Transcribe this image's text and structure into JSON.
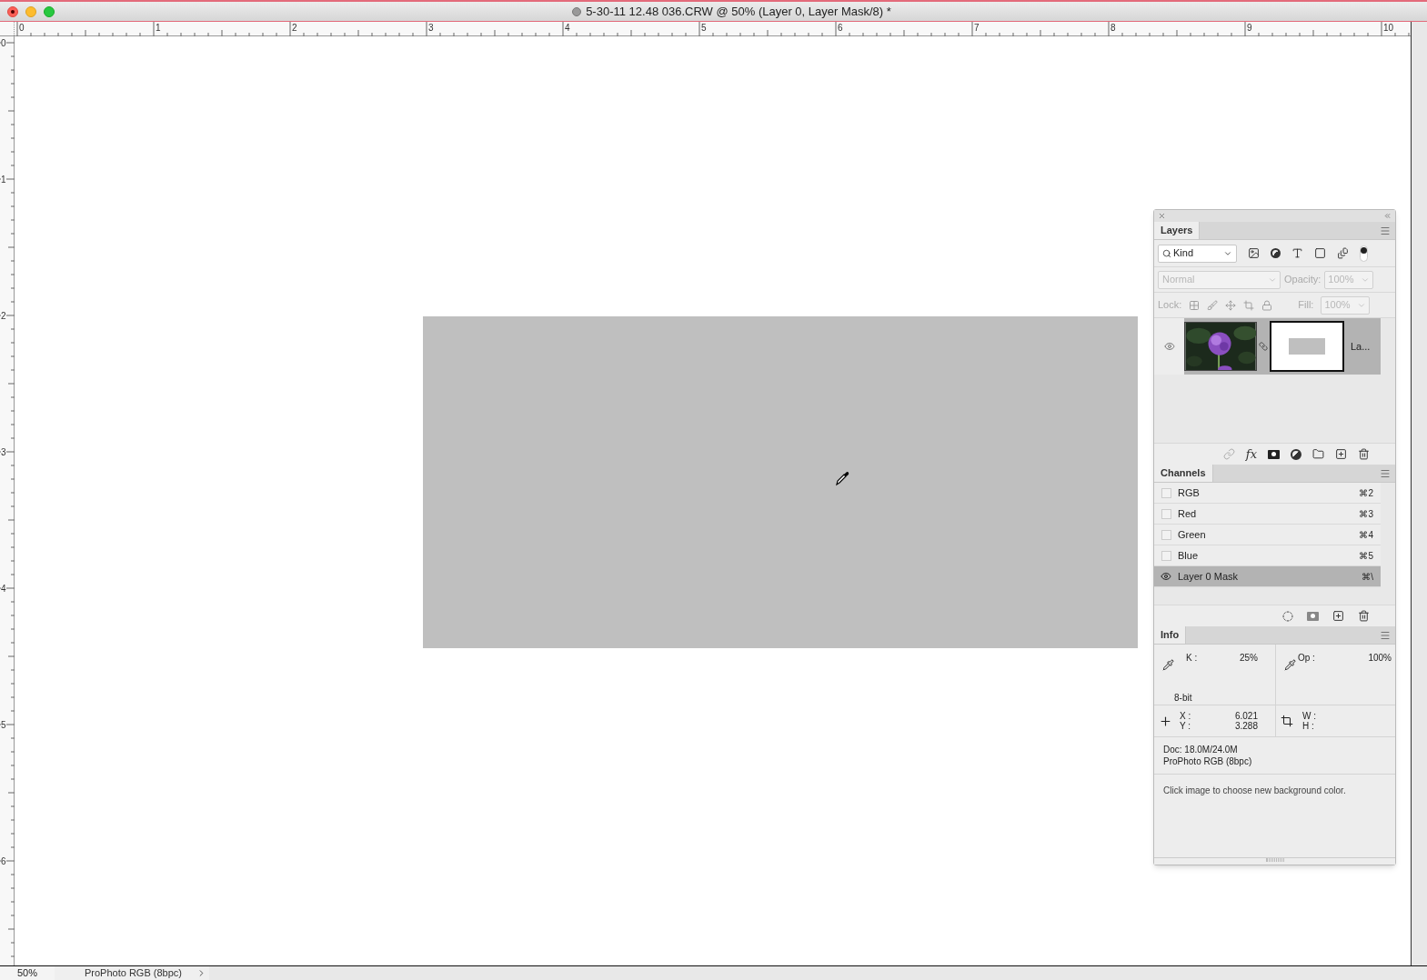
{
  "window": {
    "title": "5-30-11 12.48 036.CRW @ 50% (Layer 0, Layer Mask/8) *"
  },
  "rulers": {
    "horizontal": [
      "0",
      "1",
      "2",
      "3",
      "4",
      "5",
      "6",
      "7",
      "8",
      "9",
      "10"
    ],
    "vertical": [
      "0",
      "1",
      "2",
      "3",
      "4",
      "5",
      "6"
    ]
  },
  "layers_panel": {
    "title": "Layers",
    "filter": {
      "label": "Kind",
      "enabled": true
    },
    "fx_button": "fx",
    "blend_mode": {
      "value": "Normal",
      "disabled": true
    },
    "opacity": {
      "label": "Opacity:",
      "value": "100%",
      "disabled": true
    },
    "lock": {
      "label": "Lock:"
    },
    "fill": {
      "label": "Fill:",
      "value": "100%",
      "disabled": true
    },
    "layers": [
      {
        "name": "La...",
        "visible": true,
        "selected": true
      }
    ]
  },
  "channels_panel": {
    "title": "Channels",
    "channels": [
      {
        "name": "RGB",
        "shortcut": "⌘2",
        "visible": false,
        "selected": false
      },
      {
        "name": "Red",
        "shortcut": "⌘3",
        "visible": false,
        "selected": false
      },
      {
        "name": "Green",
        "shortcut": "⌘4",
        "visible": false,
        "selected": false
      },
      {
        "name": "Blue",
        "shortcut": "⌘5",
        "visible": false,
        "selected": false
      },
      {
        "name": "Layer 0 Mask",
        "shortcut": "⌘\\",
        "visible": true,
        "selected": true
      }
    ]
  },
  "info_panel": {
    "title": "Info",
    "k": {
      "label": "K :",
      "value": "25%"
    },
    "op": {
      "label": "Op :",
      "value": "100%"
    },
    "bit_depth": "8-bit",
    "x": {
      "label": "X :",
      "value": "6.021"
    },
    "y": {
      "label": "Y :",
      "value": "3.288"
    },
    "w": {
      "label": "W :"
    },
    "h": {
      "label": "H :"
    },
    "doc": "Doc: 18.0M/24.0M",
    "profile": "ProPhoto RGB (8bpc)",
    "hint": "Click image to choose new background color."
  },
  "status_bar": {
    "zoom": "50%",
    "profile": "ProPhoto RGB (8bpc)"
  }
}
